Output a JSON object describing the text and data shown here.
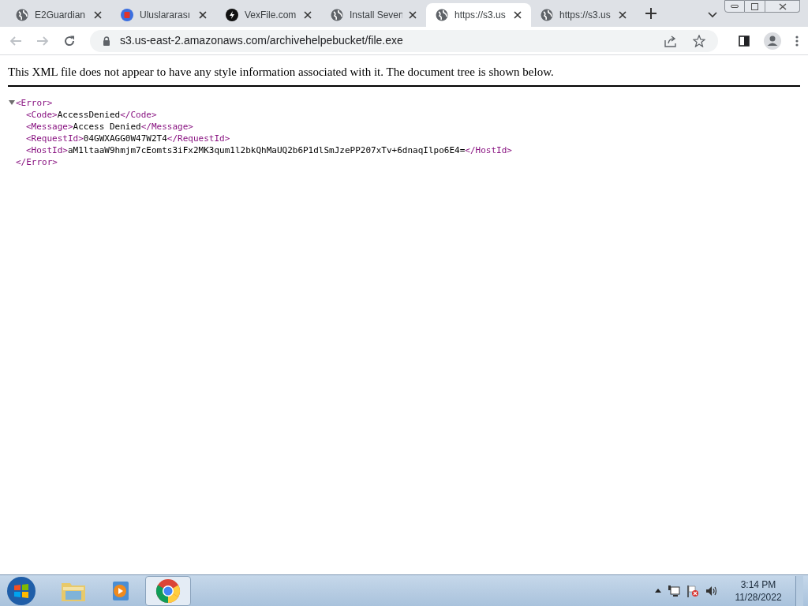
{
  "tabs": [
    {
      "title": "E2Guardian",
      "kind": "globe",
      "selected": false
    },
    {
      "title": "Uluslararası",
      "kind": "app",
      "selected": false
    },
    {
      "title": "VexFile.com",
      "kind": "dark",
      "selected": false
    },
    {
      "title": "Install Seven",
      "kind": "globe",
      "selected": false
    },
    {
      "title": "https://s3.us",
      "kind": "globe",
      "selected": true
    },
    {
      "title": "https://s3.us",
      "kind": "globe",
      "selected": false
    }
  ],
  "address_bar": {
    "url": "s3.us-east-2.amazonaws.com/archivehelpebucket/file.exe"
  },
  "notice": "This XML file does not appear to have any style information associated with it. The document tree is shown below.",
  "xml": {
    "open": "<Error>",
    "close": "</Error>",
    "expanded": true,
    "children": [
      {
        "open": "<Code>",
        "value": "AccessDenied",
        "close": "</Code>"
      },
      {
        "open": "<Message>",
        "value": "Access Denied",
        "close": "</Message>"
      },
      {
        "open": "<RequestId>",
        "value": "04GWXAGG0W47W2T4",
        "close": "</RequestId>"
      },
      {
        "open": "<HostId>",
        "value": "aM1ltaaW9hmjm7cEomts3iFx2MK3qum1l2bkQhMaUQ2b6P1dlSmJzePP207xTv+6dnaqIlpo6E4=",
        "close": "</HostId>"
      }
    ]
  },
  "taskbar": {
    "apps": [
      {
        "kind": "explorer",
        "selected": false
      },
      {
        "kind": "media",
        "selected": false
      },
      {
        "kind": "chrome",
        "selected": true
      }
    ],
    "time": "3:14 PM",
    "date": "11/28/2022"
  }
}
